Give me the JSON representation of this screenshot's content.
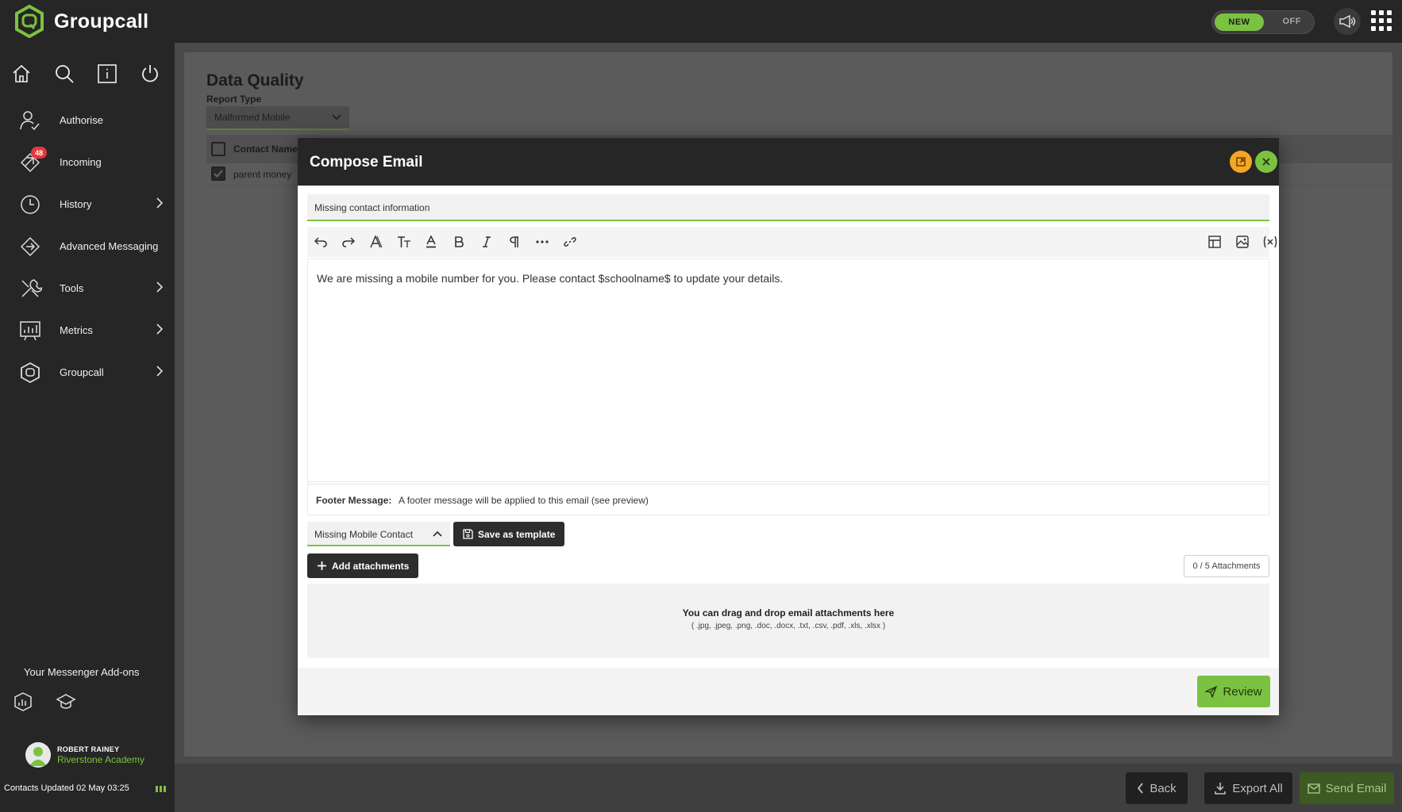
{
  "app": {
    "name": "Groupcall"
  },
  "header": {
    "toggle_on": "NEW",
    "toggle_off": "OFF"
  },
  "sidebar": {
    "items": [
      {
        "label": "Authorise"
      },
      {
        "label": "Incoming",
        "badge": "48"
      },
      {
        "label": "History"
      },
      {
        "label": "Advanced Messaging"
      },
      {
        "label": "Tools"
      },
      {
        "label": "Metrics"
      },
      {
        "label": "Groupcall"
      }
    ],
    "addons_title": "Your Messenger Add-ons",
    "user": {
      "name": "ROBERT RAINEY",
      "school": "Riverstone Academy"
    },
    "contacts_updated": "Contacts Updated 02 May 03:25"
  },
  "page": {
    "title": "Data Quality",
    "report_type_label": "Report Type",
    "report_type_value": "Malformed Mobile",
    "table": {
      "column_name": "Contact Name",
      "rows": [
        {
          "name": "parent money",
          "checked": true
        }
      ]
    }
  },
  "modal": {
    "title": "Compose Email",
    "subject": "Missing contact information",
    "body": "We are missing a mobile number for you. Please contact $schoolname$ to update your details.",
    "footer_label": "Footer Message:",
    "footer_text": "A footer message will be applied to this email (see preview)",
    "template_value": "Missing Mobile Contact",
    "save_template_label": "Save as template",
    "add_attachments_label": "Add attachments",
    "attachments_count": "0 / 5 Attachments",
    "dropzone_title": "You can drag and drop email attachments here",
    "dropzone_types": "( .jpg, .jpeg, .png, .doc, .docx, .txt, .csv, .pdf, .xls, .xlsx )",
    "review_label": "Review"
  },
  "bottom_bar": {
    "back_label": "Back",
    "export_label": "Export All",
    "send_label": "Send Email"
  },
  "colors": {
    "brand_green": "#7cc242",
    "dark": "#262626",
    "badge_red": "#e5383b",
    "expand_orange": "#f5a623"
  }
}
